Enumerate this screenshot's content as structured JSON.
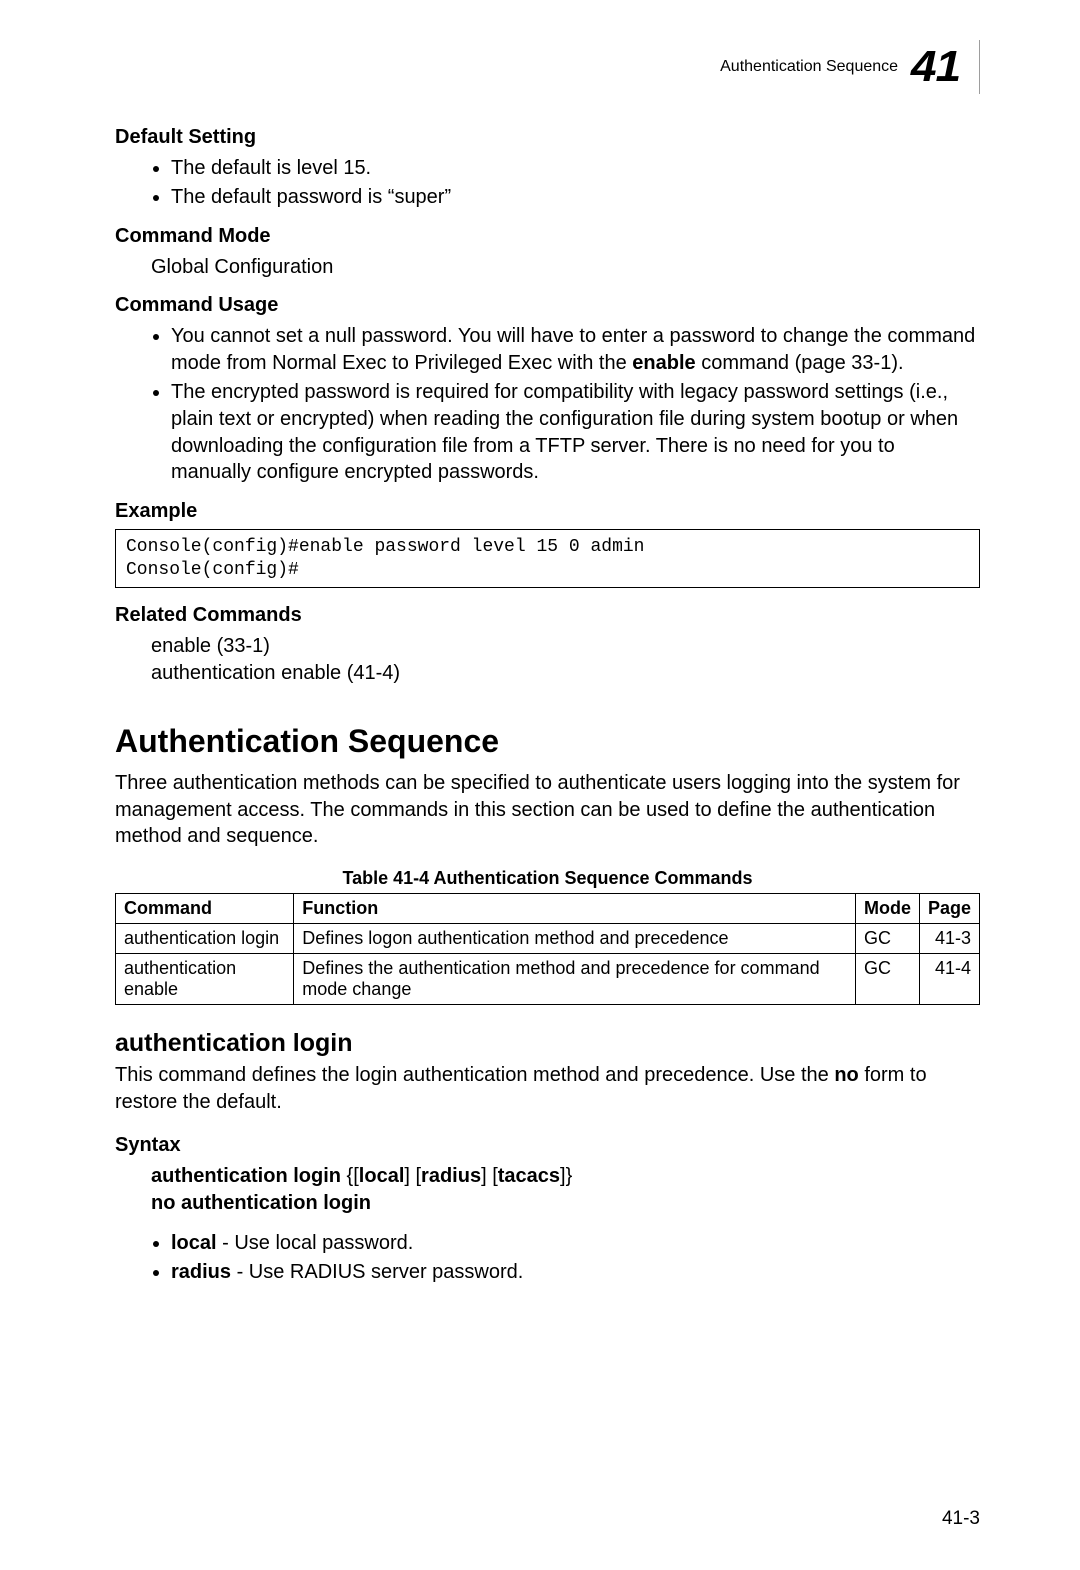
{
  "header": {
    "title": "Authentication Sequence",
    "chapter": "41"
  },
  "sections": {
    "default_setting": {
      "heading": "Default Setting",
      "bullets": [
        "The default is level 15.",
        "The default password is “super”"
      ]
    },
    "command_mode": {
      "heading": "Command Mode",
      "text": "Global Configuration"
    },
    "command_usage": {
      "heading": "Command Usage",
      "bullet1_a": "You cannot set a null password. You will have to enter a password to change the command mode from Normal Exec to Privileged Exec with the ",
      "bullet1_b": "enable",
      "bullet1_c": " command (page 33-1).",
      "bullet2": "The encrypted password is required for compatibility with legacy password settings (i.e., plain text or encrypted) when reading the configuration file during system bootup or when downloading the configuration file from a TFTP server. There is no need for you to manually configure encrypted passwords."
    },
    "example": {
      "heading": "Example",
      "code": "Console(config)#enable password level 15 0 admin\nConsole(config)#"
    },
    "related": {
      "heading": "Related Commands",
      "lines": [
        "enable (33-1)",
        "authentication enable (41-4)"
      ]
    }
  },
  "main": {
    "title": "Authentication Sequence",
    "para": "Three authentication methods can be specified to authenticate users logging into the system for management access. The commands in this section can be used to define the authentication method and sequence."
  },
  "table": {
    "caption": "Table 41-4   Authentication Sequence Commands",
    "headers": [
      "Command",
      "Function",
      "Mode",
      "Page"
    ],
    "rows": [
      [
        "authentication login",
        "Defines logon authentication method and precedence",
        "GC",
        "41-3"
      ],
      [
        "authentication enable",
        "Defines the authentication method and precedence for command mode change",
        "GC",
        "41-4"
      ]
    ]
  },
  "cmd": {
    "title": "authentication login",
    "desc_a": "This command defines the login authentication method and precedence. Use the ",
    "desc_b": "no",
    "desc_c": " form to restore the default.",
    "syntax_heading": "Syntax",
    "syntax1_a": "authentication login",
    "syntax1_b": " {[",
    "syntax1_c": "local",
    "syntax1_d": "] [",
    "syntax1_e": "radius",
    "syntax1_f": "] [",
    "syntax1_g": "tacacs",
    "syntax1_h": "]}",
    "syntax2": "no authentication login",
    "opt1_a": "local",
    "opt1_b": " - Use local password.",
    "opt2_a": "radius",
    "opt2_b": " - Use RADIUS server password."
  },
  "footer": "41-3"
}
